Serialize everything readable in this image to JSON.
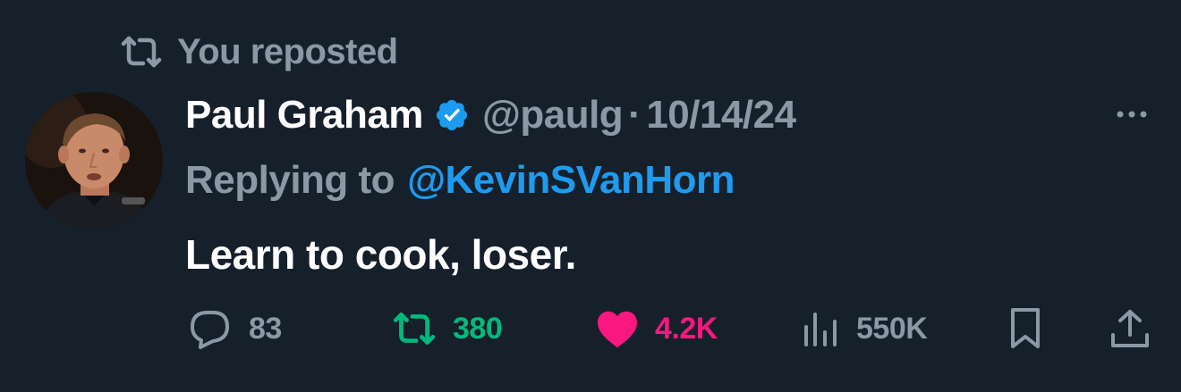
{
  "repost_header": {
    "icon": "repost-icon",
    "text": "You reposted"
  },
  "author": {
    "avatar": "avatar-photo",
    "display_name": "Paul Graham",
    "verified_icon": "verified-badge-icon",
    "handle": "@paulg",
    "separator": "·",
    "date": "10/14/24"
  },
  "more_icon": "more-options-icon",
  "reply_context": {
    "label": "Replying to",
    "user": "@KevinSVanHorn"
  },
  "tweet_text": "Learn to cook, loser.",
  "actions": {
    "reply": {
      "icon": "reply-icon",
      "count": "83"
    },
    "repost": {
      "icon": "repost-icon",
      "count": "380",
      "color": "#00ba7c"
    },
    "like": {
      "icon": "heart-icon",
      "count": "4.2K",
      "color": "#f91880"
    },
    "views": {
      "icon": "views-icon",
      "count": "550K"
    },
    "bookmark": {
      "icon": "bookmark-icon"
    },
    "share": {
      "icon": "share-icon"
    }
  },
  "colors": {
    "background": "#15202b",
    "muted": "#8b98a5",
    "accent_blue": "#1d9bf0",
    "text": "#ffffff"
  }
}
